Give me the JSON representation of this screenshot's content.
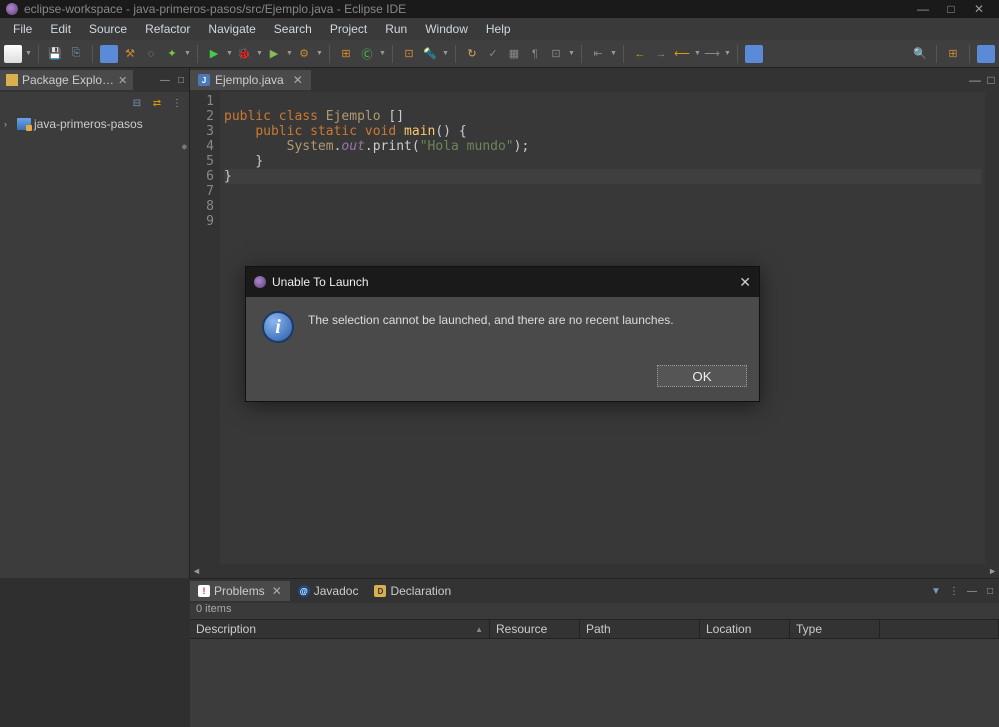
{
  "title": "eclipse-workspace - java-primeros-pasos/src/Ejemplo.java - Eclipse IDE",
  "menu": [
    "File",
    "Edit",
    "Source",
    "Refactor",
    "Navigate",
    "Search",
    "Project",
    "Run",
    "Window",
    "Help"
  ],
  "sidebar": {
    "tab": "Package Explo…",
    "project": "java-primeros-pasos"
  },
  "editor": {
    "tab": "Ejemplo.java",
    "lines": [
      "1",
      "2",
      "3",
      "4",
      "5",
      "6",
      "7",
      "8",
      "9"
    ],
    "tokens": {
      "public": "public",
      "class": "class",
      "name": "Ejemplo",
      "static": "static",
      "void": "void",
      "main": "main",
      "sys": "System",
      "out": "out",
      "print": "print",
      "str": "\"Hola mundo\"",
      "ob": "{",
      "cb": "}",
      "par": "()",
      "parOpen": "(",
      "parClose": ")",
      "semi": ";",
      "dot": ".",
      "sqOpen": "[",
      "sqClose": "]"
    }
  },
  "dialog": {
    "title": "Unable To Launch",
    "message": "The selection cannot be launched, and there are no recent launches.",
    "ok": "OK"
  },
  "bottom": {
    "tabs": [
      "Problems",
      "Javadoc",
      "Declaration"
    ],
    "status": "0 items",
    "cols": [
      "Description",
      "Resource",
      "Path",
      "Location",
      "Type"
    ]
  }
}
